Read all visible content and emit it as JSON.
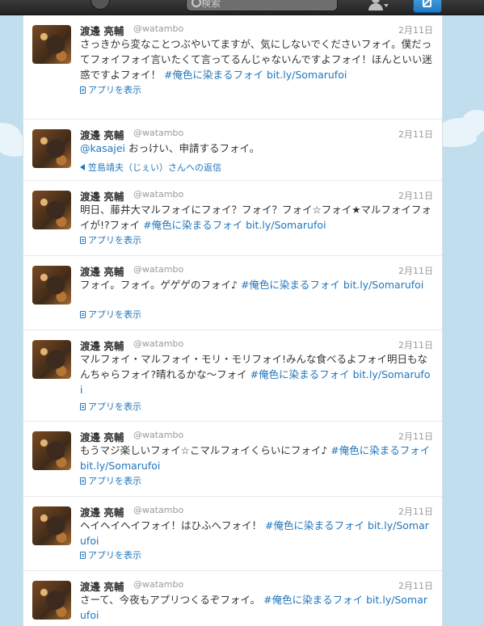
{
  "header": {
    "search_placeholder": "検索"
  },
  "tweets": [
    {
      "name": "渡邊 亮輔",
      "handle": "@watambo",
      "date": "2月11日",
      "segments": [
        {
          "text": "さっきから変なことつぶやいてますが、気にしないでくださいフォイ。僕だってフォイフォイ言いたくて言ってるんじゃないんですよフォイ！ほんといい迷惑ですよフォイ！ ",
          "link": false
        },
        {
          "text": "#俺色に染まるフォイ",
          "link": true
        },
        {
          "text": " ",
          "link": false
        },
        {
          "text": "bit.ly/Somarufoi",
          "link": true
        }
      ],
      "meta_type": "app",
      "meta_text": "アプリを表示"
    },
    {
      "name": "渡邊 亮輔",
      "handle": "@watambo",
      "date": "2月11日",
      "segments": [
        {
          "text": "@kasajei",
          "link": true
        },
        {
          "text": " おっけい、申請するフォイ。",
          "link": false
        }
      ],
      "meta_type": "reply",
      "meta_text": "笠島靖夫（じぇい）さんへの返信"
    },
    {
      "name": "渡邊 亮輔",
      "handle": "@watambo",
      "date": "2月11日",
      "segments": [
        {
          "text": "明日、藤井大マルフォイにフォイ？フォイ？フォイ☆フォイ★マルフォイフォイが!?フォイ ",
          "link": false
        },
        {
          "text": "#俺色に染まるフォイ",
          "link": true
        },
        {
          "text": " ",
          "link": false
        },
        {
          "text": "bit.ly/Somarufoi",
          "link": true
        }
      ],
      "meta_type": "app",
      "meta_text": "アプリを表示"
    },
    {
      "name": "渡邊 亮輔",
      "handle": "@watambo",
      "date": "2月11日",
      "segments": [
        {
          "text": "フォイ。フォイ。ゲゲゲのフォイ♪ ",
          "link": false
        },
        {
          "text": "#俺色に染まるフォイ",
          "link": true
        },
        {
          "text": " ",
          "link": false
        },
        {
          "text": "bit.ly/Somarufoi",
          "link": true
        }
      ],
      "meta_type": "app",
      "meta_text": "アプリを表示"
    },
    {
      "name": "渡邊 亮輔",
      "handle": "@watambo",
      "date": "2月11日",
      "segments": [
        {
          "text": "マルフォイ・マルフォイ・モリ・モリフォイ!みんな食べるよフォイ明日もなんちゃらフォイ?晴れるかな〜フォイ ",
          "link": false
        },
        {
          "text": "#俺色に染まるフォイ",
          "link": true
        },
        {
          "text": " ",
          "link": false
        },
        {
          "text": "bit.ly/Somarufoi",
          "link": true
        }
      ],
      "meta_type": "app",
      "meta_text": "アプリを表示"
    },
    {
      "name": "渡邊 亮輔",
      "handle": "@watambo",
      "date": "2月11日",
      "segments": [
        {
          "text": "もうマジ楽しいフォイ☆こマルフォイくらいにフォイ♪ ",
          "link": false
        },
        {
          "text": "#俺色に染まるフォイ",
          "link": true
        },
        {
          "text": " ",
          "link": false
        },
        {
          "text": "bit.ly/Somarufoi",
          "link": true
        }
      ],
      "meta_type": "app",
      "meta_text": "アプリを表示"
    },
    {
      "name": "渡邊 亮輔",
      "handle": "@watambo",
      "date": "2月11日",
      "segments": [
        {
          "text": "ヘイヘイヘイフォイ！はひふへフォイ！ ",
          "link": false
        },
        {
          "text": "#俺色に染まるフォイ",
          "link": true
        },
        {
          "text": " ",
          "link": false
        },
        {
          "text": "bit.ly/Somarufoi",
          "link": true
        }
      ],
      "meta_type": "app",
      "meta_text": "アプリを表示"
    },
    {
      "name": "渡邊 亮輔",
      "handle": "@watambo",
      "date": "2月11日",
      "segments": [
        {
          "text": "さーて、今夜もアプリつくるぞフォイ。 ",
          "link": false
        },
        {
          "text": "#俺色に染まるフォイ",
          "link": true
        },
        {
          "text": " ",
          "link": false
        },
        {
          "text": "bit.ly/Somarufoi",
          "link": true
        }
      ],
      "meta_type": "none",
      "meta_text": ""
    }
  ]
}
